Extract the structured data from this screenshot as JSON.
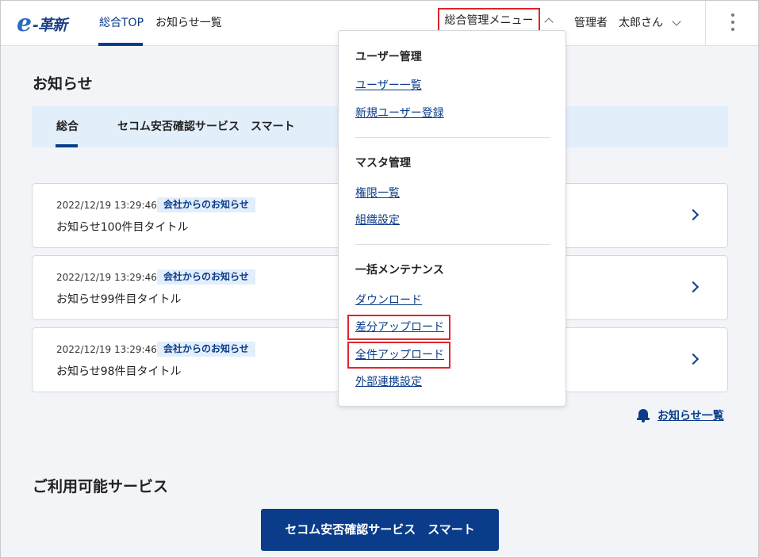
{
  "header": {
    "logo_mark": "e",
    "logo_text": "-革新",
    "nav": [
      {
        "label": "総合TOP"
      },
      {
        "label": "お知らせ一覧"
      }
    ],
    "admin_menu_label": "総合管理メニュー",
    "role": "管理者",
    "user_name": "太郎さん"
  },
  "dropdown": {
    "sections": [
      {
        "heading": "ユーザー管理",
        "links": [
          "ユーザー一覧",
          "新規ユーザー登録"
        ]
      },
      {
        "heading": "マスタ管理",
        "links": [
          "権限一覧",
          "組織設定"
        ]
      },
      {
        "heading": "一括メンテナンス",
        "links": [
          "ダウンロード",
          "差分アップロード",
          "全件アップロード",
          "外部連携設定"
        ]
      }
    ]
  },
  "news": {
    "title": "お知らせ",
    "tabs": [
      "総合",
      "セコム安否確認サービス　スマート"
    ],
    "items": [
      {
        "date": "2022/12/19 13:29:46",
        "badge": "会社からのお知らせ",
        "title": "お知らせ100件目タイトル"
      },
      {
        "date": "2022/12/19 13:29:46",
        "badge": "会社からのお知らせ",
        "title": "お知らせ99件目タイトル"
      },
      {
        "date": "2022/12/19 13:29:46",
        "badge": "会社からのお知らせ",
        "title": "お知らせ98件目タイトル"
      }
    ],
    "all_link": "お知らせ一覧"
  },
  "services": {
    "title": "ご利用可能サービス",
    "button": "セコム安否確認サービス　スマート"
  },
  "colors": {
    "brand": "#0a3c8a",
    "highlight": "#e0242b",
    "tab_bg": "#e3eefb",
    "page_bg": "#f2f4f7"
  }
}
